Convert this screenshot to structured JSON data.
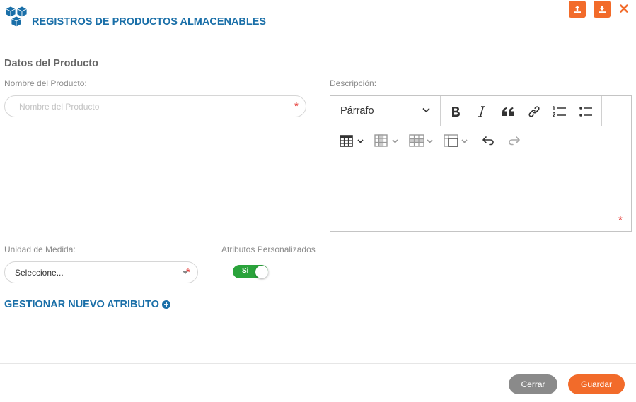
{
  "header": {
    "title": "REGISTROS DE PRODUCTOS ALMACENABLES",
    "logo_icon": "cubes-icon",
    "upload_icon": "upload-icon",
    "download_icon": "download-icon",
    "close_symbol": "✕",
    "accent_color": "#f26b2a",
    "title_color": "#1a6fa8"
  },
  "form": {
    "section_title": "Datos del Producto",
    "nombre": {
      "label": "Nombre del Producto:",
      "placeholder": "Nombre del Producto",
      "value": "",
      "required_mark": "*"
    },
    "descripcion": {
      "label": "Descripción:",
      "required_mark": "*",
      "toolbar": {
        "heading_select": "Párrafo",
        "buttons": [
          "bold-icon",
          "italic-icon",
          "blockquote-icon",
          "link-icon",
          "numbered-list-icon",
          "bulleted-list-icon",
          "insert-table-icon",
          "table-column-icon",
          "table-row-icon",
          "merge-cells-icon",
          "undo-icon",
          "redo-icon"
        ]
      },
      "content": ""
    },
    "unidad": {
      "label": "Unidad de Medida:",
      "selected": "Seleccione...",
      "required_mark": "*"
    },
    "atributos": {
      "label": "Atributos Personalizados",
      "toggle_label": "Si",
      "toggle_on": true,
      "toggle_color": "#2aa33b"
    },
    "gestionar_link": "GESTIONAR NUEVO ATRIBUTO"
  },
  "footer": {
    "cancel_label": "Cerrar",
    "save_label": "Guardar"
  }
}
